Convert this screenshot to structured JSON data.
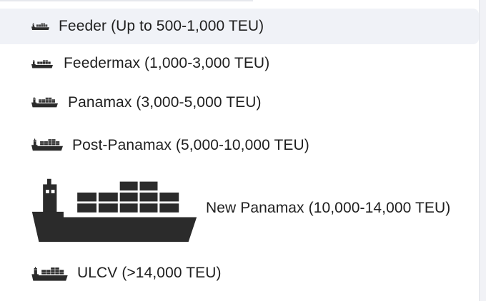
{
  "menu": {
    "items": [
      {
        "label": "Feeder (Up to 500-1,000 TEU)",
        "icon": "container-ship-icon"
      },
      {
        "label": "Feedermax (1,000-3,000 TEU)",
        "icon": "container-ship-icon"
      },
      {
        "label": "Panamax (3,000-5,000 TEU)",
        "icon": "container-ship-icon"
      },
      {
        "label": "Post-Panamax (5,000-10,000 TEU)",
        "icon": "container-ship-icon"
      },
      {
        "label": "New Panamax (10,000-14,000 TEU)",
        "icon": "container-ship-icon"
      },
      {
        "label": "ULCV (>14,000 TEU)",
        "icon": "container-ship-icon"
      }
    ]
  },
  "colors": {
    "highlight": "#f0f2f7",
    "text": "#1f1f1f",
    "icon": "#2b2b2b"
  }
}
